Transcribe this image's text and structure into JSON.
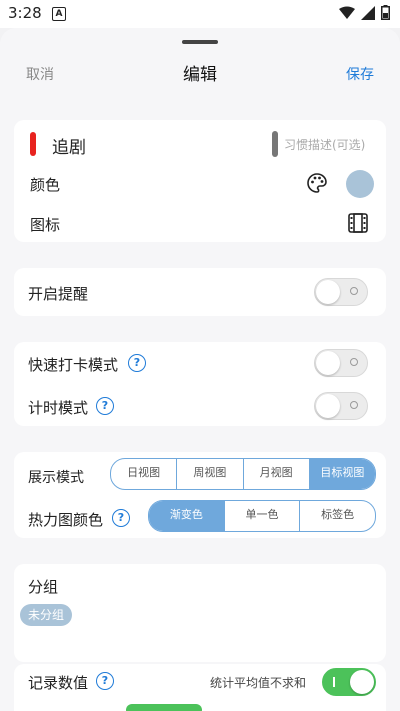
{
  "status": {
    "time": "3:28",
    "notif_glyph": "A"
  },
  "header": {
    "cancel": "取消",
    "title": "编辑",
    "save": "保存"
  },
  "habit": {
    "name": "追剧",
    "desc_placeholder": "习惯描述(可选)",
    "accent_color": "#e8231f",
    "color_label": "颜色",
    "icon_label": "图标",
    "selected_color": "#a9c3d8"
  },
  "reminder": {
    "label": "开启提醒",
    "on": false
  },
  "quick_checkin": {
    "label": "快速打卡模式",
    "on": false
  },
  "timer_mode": {
    "label": "计时模式",
    "on": false
  },
  "display_mode": {
    "label": "展示模式",
    "options": [
      "日视图",
      "周视图",
      "月视图",
      "目标视图"
    ],
    "selected": "目标视图"
  },
  "heatmap_color": {
    "label": "热力图颜色",
    "options": [
      "渐变色",
      "单一色",
      "标签色"
    ],
    "selected": "渐变色"
  },
  "group": {
    "label": "分组",
    "chip": "未分组"
  },
  "record_value": {
    "label": "记录数值",
    "avg_label": "统计平均值不求和",
    "on": true
  },
  "icons": {
    "help": "question-circle-icon",
    "palette": "palette-icon",
    "film": "film-icon",
    "wifi": "wifi-icon",
    "signal": "signal-icon",
    "battery": "battery-icon"
  }
}
